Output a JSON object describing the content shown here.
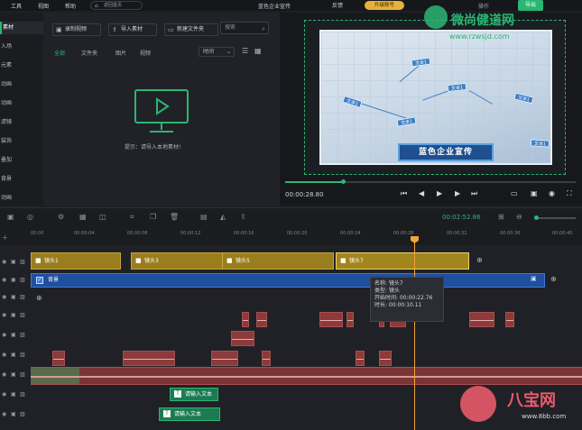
{
  "menubar": {
    "items": [
      "工具",
      "视图",
      "帮助"
    ],
    "back_home": "返回首页",
    "title": "蓝色企业宣传",
    "feedback": "反馈",
    "upgrade": "升级账号",
    "op": "操作",
    "export": "导出"
  },
  "leftnav": {
    "items": [
      "素材",
      "入场",
      "元素",
      "动画",
      "动画",
      "滤镜",
      "装饰",
      "叠加",
      "背景",
      "动画"
    ]
  },
  "media": {
    "record_btn": "录制视频",
    "import_btn": "导入素材",
    "newfolder_btn": "新建文件夹",
    "search_placeholder": "搜索",
    "tabs": [
      "全部",
      "文件夹",
      "图片",
      "视频"
    ],
    "sort": "时间",
    "empty_hint": "提示：请导入本地素材!"
  },
  "preview": {
    "card_title": "蓝色企业宣传",
    "labels": [
      "文本1",
      "文本1",
      "文本1",
      "文本1",
      "文本1",
      "文本1"
    ],
    "timecode": "00:00:28.80",
    "progress": 0.2
  },
  "toolbar": {
    "total_time": "00:02:52.86"
  },
  "ruler": {
    "ticks": [
      "00:00",
      "00:00:04",
      "00:00:08",
      "00:00:12",
      "00:00:16",
      "00:00:20",
      "00:00:24",
      "00:00:28",
      "00:00:32",
      "00:00:36",
      "00:00:40"
    ]
  },
  "tracks": {
    "clips": [
      "镜头1",
      "镜头3",
      "镜头5",
      "镜头7"
    ],
    "bg_label": "背景",
    "text_clips": [
      "请输入文本",
      "请输入文本"
    ]
  },
  "tooltip": {
    "name": "名称: 镜头7",
    "type": "类型: 镜头",
    "start": "开始时间: 00:00:22.76",
    "duration": "时长: 00:00:10.11"
  },
  "watermarks": {
    "top": "微尚健道网",
    "top_url": "www.rzwsjd.com",
    "bottom": "八宝网",
    "bottom_url": "www.8bb.com"
  },
  "colors": {
    "accent": "#2bb673",
    "clip": "#9a7d1c",
    "bg_track": "#1f4f9d",
    "audio": "#8c3a3a",
    "playhead": "#f0a43a"
  }
}
